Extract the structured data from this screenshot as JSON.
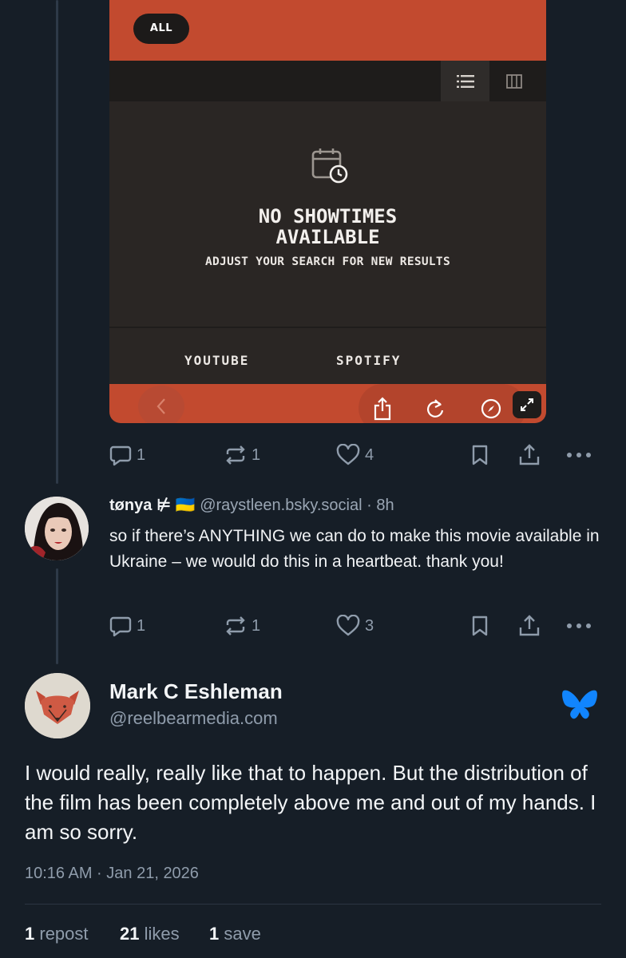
{
  "embed": {
    "filter_pill": "ALL",
    "empty_title_line1": "NO SHOWTIMES",
    "empty_title_line2": "AVAILABLE",
    "empty_subtitle": "ADJUST YOUR SEARCH FOR NEW RESULTS",
    "link_youtube": "YOUTUBE",
    "link_spotify": "SPOTIFY",
    "colors": {
      "accent": "#c24a2f",
      "dark": "#2a2624"
    }
  },
  "post1_actions": {
    "replies": "1",
    "reposts": "1",
    "likes": "4"
  },
  "reply": {
    "display_name": "tønya ⊭",
    "flag": "🇺🇦",
    "handle": "@raystleen.bsky.social",
    "time": "· 8h",
    "text": "so if there’s ANYTHING we can do to make this movie available in Ukraine – we would do this in a heartbeat. thank you!",
    "actions": {
      "replies": "1",
      "reposts": "1",
      "likes": "3"
    }
  },
  "main_post": {
    "display_name": "Mark C Eshleman",
    "handle": "@reelbearmedia.com",
    "text": "I would really, really like that to happen. But the distribution of the film has been completely above me and out of my hands. I am so sorry.",
    "timestamp": "10:16 AM · Jan 21, 2026",
    "stats": {
      "reposts_count": "1",
      "reposts_label": "repost",
      "likes_count": "21",
      "likes_label": "likes",
      "saves_count": "1",
      "saves_label": "save"
    },
    "brand_color": "#1185fe"
  },
  "icons": [
    "reply-icon",
    "repost-icon",
    "like-icon",
    "bookmark-icon",
    "share-icon",
    "more-icon",
    "butterfly-icon",
    "calendar-clock-icon",
    "list-view-icon",
    "grid-view-icon",
    "back-icon",
    "share-sheet-icon",
    "reload-icon",
    "compass-icon",
    "expand-icon"
  ]
}
